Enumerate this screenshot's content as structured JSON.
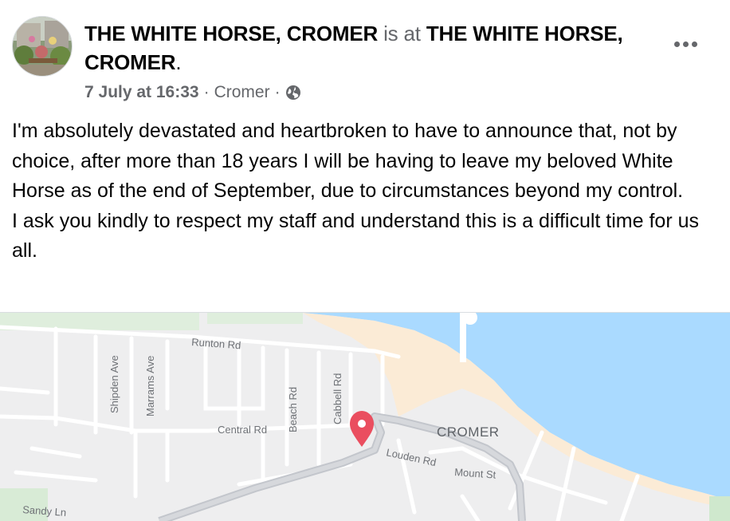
{
  "post": {
    "author": "THE WHITE HORSE, CROMER",
    "connector": "is at",
    "location_tag": "THE WHITE HORSE,",
    "location_tag_2": "CROMER",
    "location_tag_end": ".",
    "timestamp": "7 July at 16:33",
    "separator": "·",
    "place": "Cromer",
    "audience_icon": "globe-icon",
    "menu_icon": "more-horizontal-icon",
    "body_lines": [
      "I'm absolutely devastated and heartbroken to have to announce that, not by choice, after more than 18 years I will be having to leave my beloved White Horse as of the end of September, due to circumstances beyond my control.",
      "I ask you kindly to respect my staff and understand this is a difficult time for us all."
    ]
  },
  "map": {
    "town_label": "CROMER",
    "streets": {
      "runton": "Runton Rd",
      "shipden": "Shipden Ave",
      "marrams": "Marrams Ave",
      "beach": "Beach Rd",
      "cabbell": "Cabbell Rd",
      "central": "Central Rd",
      "louden": "Louden Rd",
      "mount": "Mount St",
      "sandy": "Sandy Ln"
    },
    "pin_icon": "map-pin-icon",
    "colors": {
      "sea": "#aadaff",
      "land": "#eeeeef",
      "beach": "#fbebd6",
      "green": "#d4ecd3",
      "pin": "#ea4e5f"
    }
  }
}
